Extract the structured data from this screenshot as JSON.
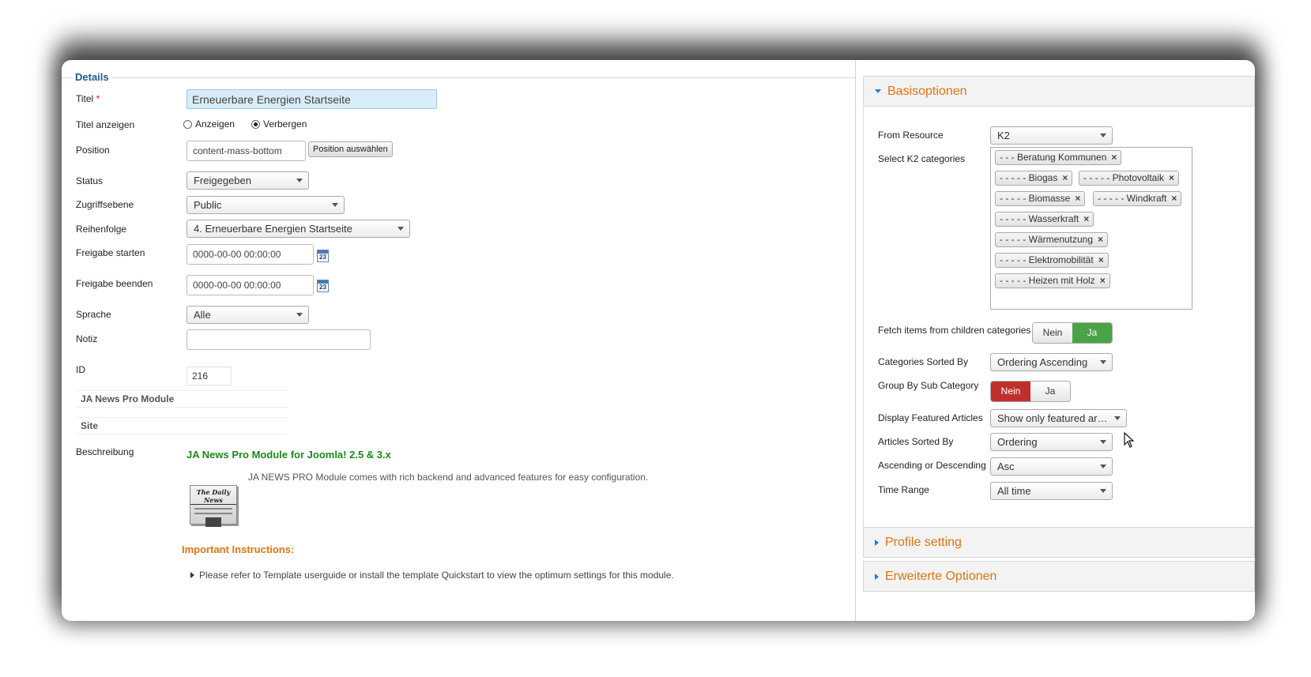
{
  "details": {
    "legend": "Details",
    "fields": {
      "title_label": "Titel",
      "title_required": "*",
      "title_value": "Erneuerbare Energien Startseite",
      "show_title_label": "Titel anzeigen",
      "show_option": "Anzeigen",
      "hide_option": "Verbergen",
      "position_label": "Position",
      "position_value": "content-mass-bottom",
      "position_button": "Position auswählen",
      "status_label": "Status",
      "status_value": "Freigegeben",
      "access_label": "Zugriffsebene",
      "access_value": "Public",
      "order_label": "Reihenfolge",
      "order_value": "4. Erneuerbare Energien Startseite",
      "publish_up_label": "Freigabe starten",
      "publish_up_value": "0000-00-00 00:00:00",
      "publish_down_label": "Freigabe beenden",
      "publish_down_value": "0000-00-00 00:00:00",
      "calendar_day": "23",
      "language_label": "Sprache",
      "language_value": "Alle",
      "note_label": "Notiz",
      "note_value": "",
      "id_label": "ID",
      "id_value": "216",
      "module_name": "JA News Pro Module",
      "client": "Site",
      "description_label": "Beschreibung"
    },
    "description": {
      "title": "JA News Pro Module for Joomla! 2.5 & 3.x",
      "text": "JA NEWS PRO Module comes with rich backend and advanced features for easy configuration.",
      "icon_headline": "The Daily News",
      "important": "Important Instructions:",
      "bullet": "Please refer to Template userguide or install the template Quickstart to view the optimum settings for this module."
    }
  },
  "panel": {
    "basic_title": "Basisoptionen",
    "profile_title": "Profile setting",
    "advanced_title": "Erweiterte Optionen",
    "from_resource_label": "From Resource",
    "from_resource_value": "K2",
    "k2_categories_label": "Select K2 categories",
    "k2_categories": [
      "- - - Beratung Kommunen",
      "- - - - - Biogas",
      "- - - - - Photovoltaik",
      "- - - - - Biomasse",
      "- - - - - Windkraft",
      "- - - - - Wasserkraft",
      "- - - - - Wärmenutzung",
      "- - - - - Elektromobilität",
      "- - - - - Heizen mit Holz"
    ],
    "chip_remove": "×",
    "fetch_children_label": "Fetch items from children categories",
    "no_label": "Nein",
    "yes_label": "Ja",
    "categories_sorted_label": "Categories Sorted By",
    "categories_sorted_value": "Ordering Ascending",
    "group_by_label": "Group By Sub Category",
    "featured_label": "Display Featured Articles",
    "featured_value": "Show only featured arti...",
    "articles_sorted_label": "Articles Sorted By",
    "articles_sorted_value": "Ordering",
    "direction_label": "Ascending or Descending",
    "direction_value": "Asc",
    "time_range_label": "Time Range",
    "time_range_value": "All time"
  }
}
